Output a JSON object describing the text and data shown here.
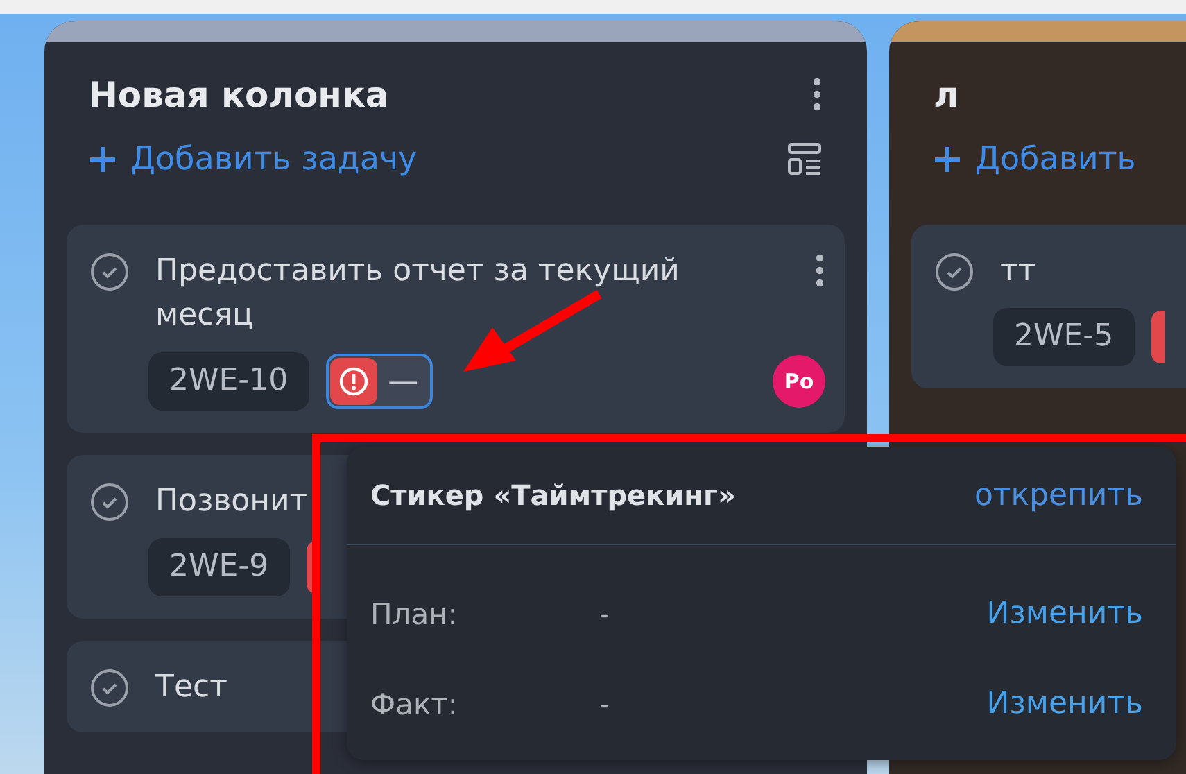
{
  "columns": [
    {
      "title": "Новая колонка",
      "add_task": "Добавить задачу",
      "has_menu": true,
      "color": "#9aa5bc",
      "cards": [
        {
          "title": "Предоставить отчет за текущий месяц",
          "code": "2WE-10",
          "has_menu": true,
          "sticker": {
            "kind": "full",
            "active": true,
            "value": "—"
          },
          "assignee": "Po"
        },
        {
          "title": "Позвонит",
          "code": "2WE-9",
          "has_menu": false,
          "sticker": {
            "kind": "edge"
          }
        },
        {
          "title": "Тест",
          "has_menu": false
        }
      ]
    },
    {
      "title": "л",
      "add_task": "Добавить",
      "has_menu": false,
      "color": "#c4955f",
      "cards": [
        {
          "title": "тт",
          "code": "2WE-5",
          "has_menu": false,
          "sticker": {
            "kind": "edge"
          }
        }
      ]
    }
  ],
  "popup": {
    "title": "Стикер «Таймтрекинг»",
    "unpin": "открепить",
    "rows": [
      {
        "label": "План:",
        "value": "-",
        "action": "Изменить"
      },
      {
        "label": "Факт:",
        "value": "-",
        "action": "Изменить"
      }
    ]
  },
  "annotation": {
    "frame": true,
    "arrow": true
  }
}
